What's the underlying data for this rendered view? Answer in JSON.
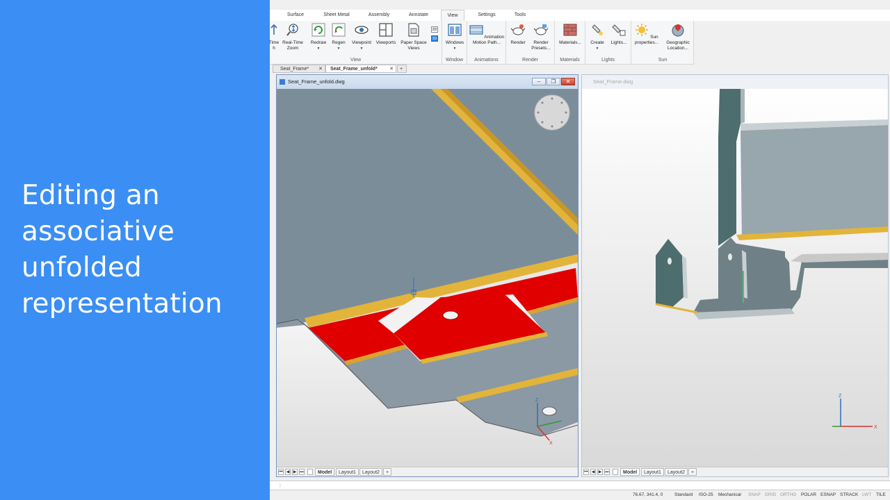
{
  "caption": {
    "lines": [
      "Editing an",
      "associative",
      "unfolded",
      "representation"
    ]
  },
  "ribbon": {
    "tabs": [
      "Surface",
      "Sheet Metal",
      "Assembly",
      "Annotate",
      "View",
      "Settings",
      "Tools"
    ],
    "active_tab": "View",
    "groups": {
      "view": {
        "label": "View",
        "buttons": [
          {
            "label": "Time\nh",
            "icon": "realtime-pan-icon"
          },
          {
            "label": "Real-Time\nZoom",
            "icon": "realtime-zoom-icon"
          },
          {
            "label": "Redraw",
            "icon": "redraw-icon"
          },
          {
            "label": "Regen",
            "icon": "regen-icon"
          },
          {
            "label": "Viewpoint",
            "icon": "viewpoint-icon"
          },
          {
            "label": "Viewports",
            "icon": "viewports-icon"
          },
          {
            "label": "Paper Space\nViews",
            "icon": "paper-space-icon"
          }
        ]
      },
      "window": {
        "label": "Window",
        "button": "Windows"
      },
      "animations": {
        "label": "Animations",
        "button": "Animation\nMotion Path..."
      },
      "render": {
        "label": "Render",
        "buttons": [
          "Render",
          "Render\nPresets..."
        ]
      },
      "materials": {
        "label": "Materials",
        "button": "Materials..."
      },
      "lights": {
        "label": "Lights",
        "buttons": [
          "Create",
          "Lights..."
        ]
      },
      "sun": {
        "label": "Sun",
        "buttons": [
          "Sun\nproperties...",
          "Geographic\nLocation..."
        ]
      }
    }
  },
  "doc_tabs": [
    {
      "label": "Seat_Frame*",
      "active": false
    },
    {
      "label": "Seat_Frame_unfold*",
      "active": true
    },
    {
      "label": "+",
      "active": false
    }
  ],
  "viewports": {
    "left": {
      "title": "Seat_Frame_unfold.dwg",
      "layouts": [
        "Model",
        "Layout1",
        "Layout2",
        "+"
      ]
    },
    "right": {
      "title": "Seat_Frame.dwg",
      "layouts": [
        "Model",
        "Layout1",
        "Layout2",
        "+"
      ]
    }
  },
  "command_line": {
    "prompt": ":"
  },
  "status_bar": {
    "coords": "76.67, 341.4, 0",
    "items": [
      {
        "label": "Standard",
        "on": true
      },
      {
        "label": "ISO-25",
        "on": true
      },
      {
        "label": "Mechanical",
        "on": true
      },
      {
        "label": "SNAP",
        "on": false
      },
      {
        "label": "GRID",
        "on": false
      },
      {
        "label": "ORTHO",
        "on": false
      },
      {
        "label": "POLAR",
        "on": true
      },
      {
        "label": "ESNAP",
        "on": true
      },
      {
        "label": "STRACK",
        "on": true
      },
      {
        "label": "LWT",
        "on": false
      },
      {
        "label": "TILE",
        "on": true
      }
    ]
  },
  "colors": {
    "caption_bg": "#3b8ef3",
    "sheet_gray": "#7c8d9a",
    "flange_red": "#e10000",
    "edge_gold": "#e2b43a",
    "teal_part": "#4d6d6e"
  }
}
